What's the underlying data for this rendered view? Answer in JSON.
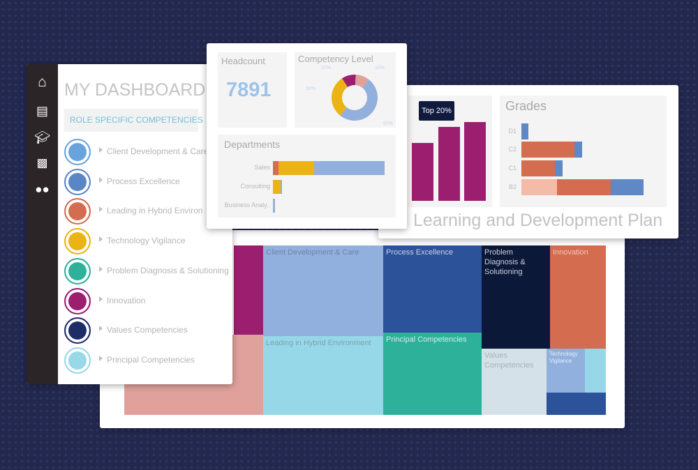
{
  "sidebar": {
    "nav": [
      {
        "icon": "home-icon"
      },
      {
        "icon": "contact-card-icon"
      },
      {
        "icon": "graduation-cap-icon"
      },
      {
        "icon": "bar-chart-icon"
      },
      {
        "icon": "team-icon"
      }
    ],
    "title": "MY DASHBOARD",
    "section": "ROLE SPECIFIC COMPETENCIES",
    "competencies": [
      {
        "label": "Client Development & Care",
        "color": "#6aa3dc"
      },
      {
        "label": "Process Excellence",
        "color": "#5b86c6"
      },
      {
        "label": "Leading in Hybrid Environ",
        "color": "#d46c50"
      },
      {
        "label": "Technology Vigilance",
        "color": "#ecb315"
      },
      {
        "label": "Problem Diagnosis & Solutioning",
        "color": "#2db19b"
      },
      {
        "label": "Innovation",
        "color": "#9c1f6f"
      },
      {
        "label": "Values Competencies",
        "color": "#1e2c68"
      },
      {
        "label": "Principal Competencies",
        "color": "#98d8e8"
      }
    ]
  },
  "headcount": {
    "title": "Headcount",
    "value": "7891"
  },
  "chart_data": [
    {
      "type": "pie",
      "title": "Competency Level",
      "slices": [
        {
          "label": "10%",
          "value": 10,
          "color": "#e0a19d"
        },
        {
          "label": "50%",
          "value": 50,
          "color": "#92b0dd"
        },
        {
          "label": "30%",
          "value": 30,
          "color": "#ecb315"
        },
        {
          "label": "10%",
          "value": 10,
          "color": "#9c1f6f"
        }
      ]
    },
    {
      "type": "bar",
      "orientation": "horizontal",
      "stacked": true,
      "title": "Departments",
      "categories": [
        "Sales",
        "Consulting",
        "Business Analy.."
      ],
      "series": [
        {
          "color": "#d46c50",
          "values": [
            8,
            0,
            0
          ]
        },
        {
          "color": "#ecb315",
          "values": [
            51,
            11,
            0
          ]
        },
        {
          "color": "#92b0dd",
          "values": [
            101,
            2,
            3
          ]
        }
      ]
    },
    {
      "type": "bar",
      "annotation": "Top 20%",
      "color": "#9c1f6f",
      "values": [
        83,
        106,
        113
      ],
      "ylim": [
        0,
        120
      ]
    },
    {
      "type": "bar",
      "orientation": "horizontal",
      "stacked": true,
      "title": "Grades",
      "categories": [
        "D1",
        "C2",
        "C1",
        "B2"
      ],
      "series": [
        {
          "color": "#f5bba9",
          "values": [
            0,
            0,
            0,
            51
          ]
        },
        {
          "color": "#d46c50",
          "values": [
            0,
            76,
            48,
            77
          ]
        },
        {
          "color": "#5e88c6",
          "values": [
            10,
            11,
            11,
            47
          ]
        }
      ]
    },
    {
      "type": "treemap",
      "cells": [
        {
          "label": "",
          "color": "#9c1f6f"
        },
        {
          "label": "",
          "color": "#e0a19d"
        },
        {
          "label": "Client Development & Care",
          "color": "#92b0dd",
          "text": "#6c82a8"
        },
        {
          "label": "Leading in Hybrid Environment",
          "color": "#96d8e8",
          "text": "#7ba2b0"
        },
        {
          "label": "Process Excellence",
          "color": "#2c5299",
          "text": "#c7d3ea"
        },
        {
          "label": "Principal Competencies",
          "color": "#2db19b",
          "text": "#d1eee8"
        },
        {
          "label": "Problem Diagnosis & Solutioning",
          "color": "#0c1838",
          "text": "#c9cfdc"
        },
        {
          "label": "Innovation",
          "color": "#d46c50",
          "text": "#f3c6b8"
        },
        {
          "label": "Values Competencies",
          "color": "#d5e1e8",
          "text": "#a7b2b8"
        },
        {
          "label": "Technology Vigilance",
          "color": "#92b0dd",
          "text": "#e6eef8"
        },
        {
          "label": "",
          "color": "#96d8e8"
        },
        {
          "label": "",
          "color": "#2c5299"
        }
      ]
    }
  ],
  "ldp": {
    "title": "Learning and Development Plan"
  }
}
